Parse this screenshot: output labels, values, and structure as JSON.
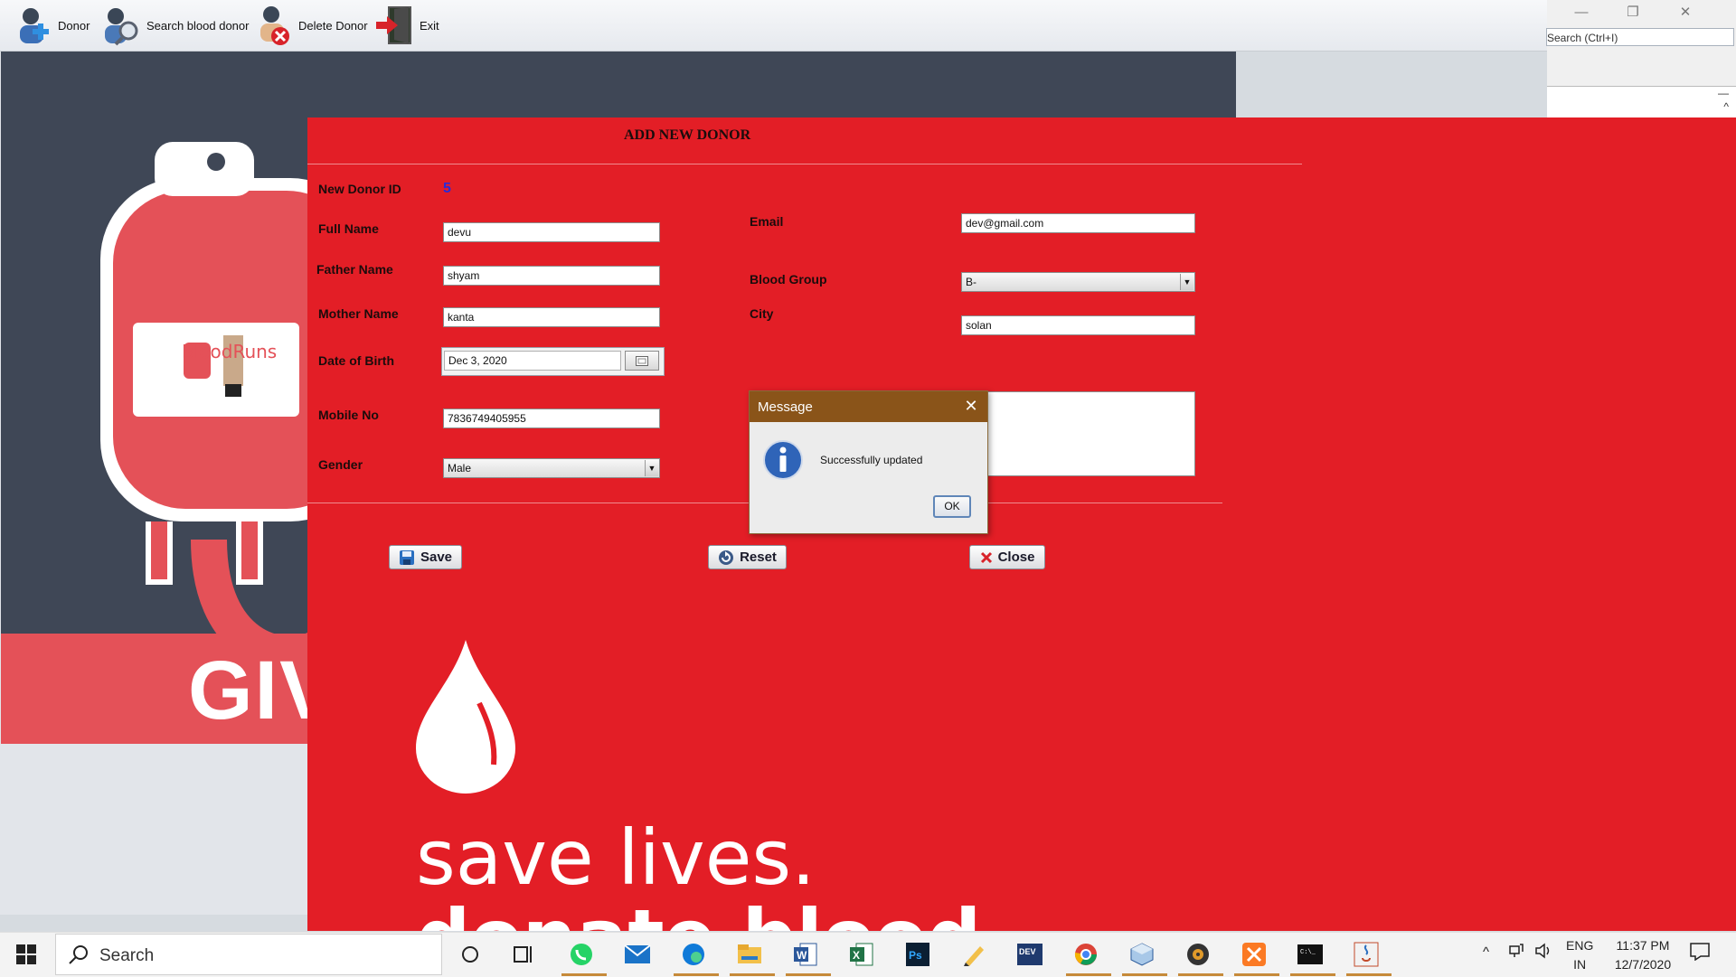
{
  "toolbar": {
    "items": [
      {
        "label": "Donor",
        "icon": "add-donor-icon"
      },
      {
        "label": "Search blood donor",
        "icon": "search-donor-icon"
      },
      {
        "label": "Delete Donor",
        "icon": "delete-donor-icon"
      },
      {
        "label": "Exit",
        "icon": "exit-door-icon"
      }
    ]
  },
  "ide": {
    "search_placeholder": "Search (Ctrl+I)",
    "win_minimize": "—",
    "win_restore": "❐",
    "win_close": "✕"
  },
  "poster": {
    "logo_text": "BloodRuns",
    "give_text": "GIV",
    "slogan_line1": "save lives.",
    "slogan_line2": "donate blood"
  },
  "form": {
    "title": "ADD NEW DONOR",
    "donor_id_label": "New Donor ID",
    "donor_id_value": "5",
    "full_name_label": "Full Name",
    "full_name_value": "devu",
    "father_name_label": "Father Name",
    "father_name_value": "shyam",
    "mother_name_label": "Mother Name",
    "mother_name_value": "kanta",
    "dob_label": "Date of Birth",
    "dob_value": "Dec 3, 2020",
    "mobile_label": "Mobile No",
    "mobile_value": "7836749405955",
    "gender_label": "Gender",
    "gender_value": "Male",
    "email_label": "Email",
    "email_value": "dev@gmail.com",
    "blood_group_label": "Blood Group",
    "blood_group_value": "B-",
    "city_label": "City",
    "city_value": "solan",
    "save_button": "Save",
    "reset_button": "Reset",
    "close_button": "Close"
  },
  "dialog": {
    "title": "Message",
    "message": "Successfully updated",
    "ok_button": "OK"
  },
  "taskbar": {
    "search_text": "Search",
    "lang_line1": "ENG",
    "lang_line2": "IN",
    "time": "11:37 PM",
    "date": "12/7/2020",
    "apps": [
      "task-view-icon",
      "whatsapp-icon",
      "mail-icon",
      "edge-icon",
      "file-explorer-icon",
      "word-icon",
      "excel-icon",
      "photoshop-icon",
      "notepad-icon",
      "devcpp-icon",
      "chrome-icon",
      "virtualbox-icon",
      "media-player-icon",
      "xampp-icon",
      "terminal-icon",
      "java-icon"
    ]
  },
  "colors": {
    "form_bg": "#e31e26",
    "poster_dark": "#3f4756",
    "dialog_title_bg": "#8a5419",
    "donor_id_color": "#2a2ad8"
  }
}
